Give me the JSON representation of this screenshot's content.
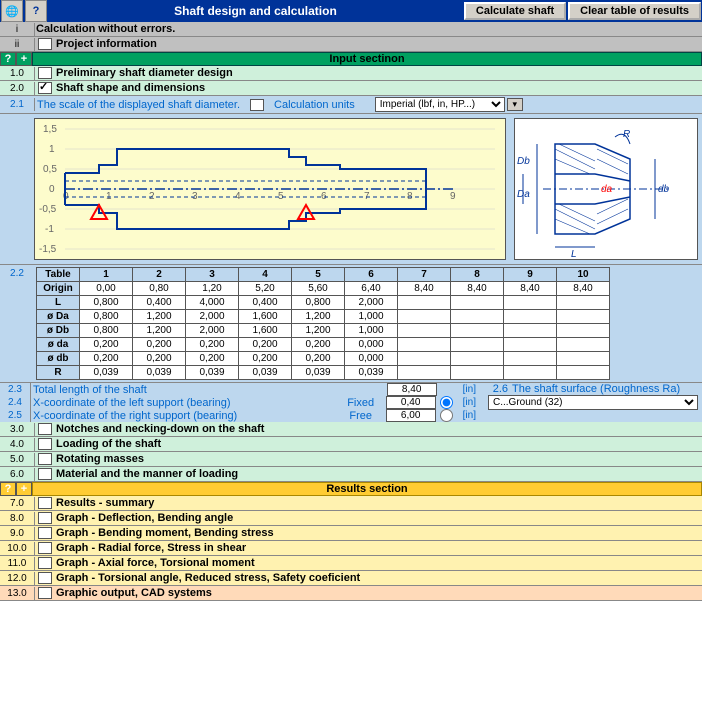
{
  "top": {
    "title": "Shaft design and calculation",
    "btn_calc": "Calculate shaft",
    "btn_clear": "Clear table of results"
  },
  "hdr_i": "i",
  "hdr_i_txt": "Calculation without errors.",
  "hdr_ii": "ii",
  "hdr_ii_txt": "Project information",
  "input_section": "Input sectinon",
  "s1_0": "1.0",
  "s1_0_txt": "Preliminary shaft diameter design",
  "s2_0": "2.0",
  "s2_0_txt": "Shaft shape and dimensions",
  "s2_1": "2.1",
  "s2_1_a": "The scale of the displayed shaft diameter.",
  "s2_1_b": "Calculation units",
  "units_sel": "Imperial (lbf, in, HP...)",
  "s2_2": "2.2",
  "tbl": {
    "th": [
      "Table",
      "1",
      "2",
      "3",
      "4",
      "5",
      "6",
      "7",
      "8",
      "9",
      "10"
    ],
    "origin": [
      "Origin",
      "0,00",
      "0,80",
      "1,20",
      "5,20",
      "5,60",
      "6,40",
      "8,40",
      "8,40",
      "8,40",
      "8,40"
    ],
    "L": [
      "L",
      "0,800",
      "0,400",
      "4,000",
      "0,400",
      "0,800",
      "2,000",
      "",
      "",
      "",
      ""
    ],
    "Da": [
      "ø Da",
      "0,800",
      "1,200",
      "2,000",
      "1,600",
      "1,200",
      "1,000",
      "",
      "",
      "",
      ""
    ],
    "Db": [
      "ø Db",
      "0,800",
      "1,200",
      "2,000",
      "1,600",
      "1,200",
      "1,000",
      "",
      "",
      "",
      ""
    ],
    "da_": [
      "ø da",
      "0,200",
      "0,200",
      "0,200",
      "0,200",
      "0,200",
      "0,000",
      "",
      "",
      "",
      ""
    ],
    "db_": [
      "ø db",
      "0,200",
      "0,200",
      "0,200",
      "0,200",
      "0,200",
      "0,000",
      "",
      "",
      "",
      ""
    ],
    "R": [
      "R",
      "0,039",
      "0,039",
      "0,039",
      "0,039",
      "0,039",
      "0,039",
      "",
      "",
      "",
      ""
    ]
  },
  "s2_3": "2.3",
  "s2_3_txt": "Total length of the shaft",
  "s2_3_v": "8,40",
  "s2_3_u": "[in]",
  "s2_4": "2.4",
  "s2_4_txt": "X-coordinate of the left support (bearing)",
  "s2_4_f": "Fixed",
  "s2_4_v": "0,40",
  "s2_4_u": "[in]",
  "s2_5": "2.5",
  "s2_5_txt": "X-coordinate of the right support (bearing)",
  "s2_5_f": "Free",
  "s2_5_v": "6,00",
  "s2_5_u": "[in]",
  "s2_6": "2.6",
  "s2_6_txt": "The shaft surface (Roughness Ra)",
  "s2_6_sel": "C...Ground  (32)",
  "s3_0": "3.0",
  "s3_0_txt": "Notches and necking-down on the shaft",
  "s4_0": "4.0",
  "s4_0_txt": "Loading of the shaft",
  "s5_0": "5.0",
  "s5_0_txt": "Rotating masses",
  "s6_0": "6.0",
  "s6_0_txt": "Material and the manner of loading",
  "results_section": "Results section",
  "s7_0": "7.0",
  "s7_0_txt": "Results - summary",
  "s8_0": "8.0",
  "s8_0_txt": "Graph - Deflection, Bending angle",
  "s9_0": "9.0",
  "s9_0_txt": "Graph - Bending moment, Bending stress",
  "s10_0": "10.0",
  "s10_0_txt": "Graph - Radial force, Stress in shear",
  "s11_0": "11.0",
  "s11_0_txt": "Graph - Axial force,   Torsional moment",
  "s12_0": "12.0",
  "s12_0_txt": "Graph - Torsional angle,   Reduced stress,   Safety coeficient",
  "s13_0": "13.0",
  "s13_0_txt": "Graphic output, CAD systems",
  "chart_data": {
    "type": "line",
    "title": "",
    "xlabel": "",
    "ylabel": "",
    "xlim": [
      -1,
      9
    ],
    "ylim": [
      -1.5,
      1.5
    ],
    "y_ticks": [
      -1.5,
      -1,
      -0.5,
      0,
      0.5,
      1,
      1.5
    ],
    "x_ticks": [
      0,
      1,
      2,
      3,
      4,
      5,
      6,
      7,
      8,
      9
    ],
    "shaft_profile_top": [
      [
        0,
        0.4
      ],
      [
        0.8,
        0.4
      ],
      [
        0.8,
        0.6
      ],
      [
        1.2,
        0.6
      ],
      [
        1.2,
        1.0
      ],
      [
        5.2,
        1.0
      ],
      [
        5.2,
        0.8
      ],
      [
        5.6,
        0.8
      ],
      [
        5.6,
        0.6
      ],
      [
        6.4,
        0.6
      ],
      [
        6.4,
        0.5
      ],
      [
        8.4,
        0.5
      ]
    ],
    "supports_x": [
      0.8,
      5.6
    ]
  },
  "dim_labels": {
    "R": "R",
    "Db": "Db",
    "Da": "Da",
    "da": "da",
    "db": "db",
    "L": "L"
  }
}
